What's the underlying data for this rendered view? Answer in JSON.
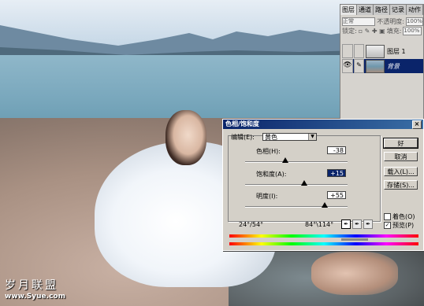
{
  "watermark": {
    "line1": "岁月联盟",
    "line2": "www.Syue.com"
  },
  "layers_panel": {
    "tabs": [
      "图层",
      "通道",
      "路径",
      "记录",
      "动作"
    ],
    "blend_mode": "正常",
    "opacity_label": "不透明度:",
    "opacity_value": "100%",
    "lock_label": "锁定:",
    "fill_label": "填充:",
    "fill_value": "100%",
    "layers": [
      {
        "name": "图层 1",
        "selected": false
      },
      {
        "name": "背景",
        "selected": true
      }
    ]
  },
  "dialog": {
    "title": "色相/饱和度",
    "close_glyph": "×",
    "edit_label": "编辑(E):",
    "edit_value": "黄色",
    "hue_label": "色相(H):",
    "hue_value": "-38",
    "hue_level": 0.395,
    "sat_label": "饱和度(A):",
    "sat_value": "+15",
    "sat_level": 0.575,
    "light_label": "明度(I):",
    "light_value": "+55",
    "light_level": 0.775,
    "range_left": "24°/54°",
    "range_right": "84°\\114°",
    "buttons": {
      "ok": "好",
      "cancel": "取消",
      "load": "载入(L)...",
      "save": "存储(S)..."
    },
    "colorize_label": "着色(O)",
    "colorize_checked": false,
    "preview_label": "预览(P)",
    "preview_checked": true
  },
  "colors": {
    "titlebar": "#0a246a",
    "dialog_bg": "#d4d0c8"
  }
}
